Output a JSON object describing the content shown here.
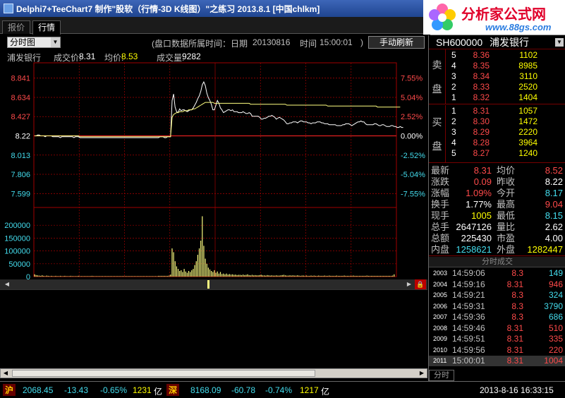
{
  "window": {
    "title": "Delphi7+TeeChart7 制作\"股软（行情-3D K线图）\"之练习  2013.8.1 [中国chlkm]"
  },
  "logo": {
    "brand": "分析家公式网",
    "url": "www.88gs.com"
  },
  "tabs": [
    {
      "label": "报价"
    },
    {
      "label": "行情"
    }
  ],
  "toolbar": {
    "chart_type": "分时图",
    "date_label": "(盘口数据所属时间：日期",
    "date_value": "20130816",
    "time_label": "时间",
    "time_value": "15:00:01",
    "time_close": ")",
    "refresh_label": "手动刷新"
  },
  "info": {
    "stock_name": "浦发银行",
    "price_label": "成交价:",
    "price_value": "8.31",
    "avg_label": "均价:",
    "avg_value": "8.53",
    "vol_label": "成交量:",
    "vol_value": "9282"
  },
  "chart_data": {
    "type": "line",
    "price_axis_labels": [
      "8.841",
      "8.634",
      "8.427",
      "8.22",
      "8.013",
      "7.806",
      "7.599"
    ],
    "price_axis_values": [
      8.841,
      8.634,
      8.427,
      8.22,
      8.013,
      7.806,
      7.599
    ],
    "percent_axis_labels": [
      "7.55%",
      "5.04%",
      "2.52%",
      "0.00%",
      "-2.52%",
      "-5.04%",
      "-7.55%"
    ],
    "volume_axis_labels": [
      "200000",
      "150000",
      "100000",
      "50000",
      "0"
    ],
    "volume_axis_values": [
      200000,
      150000,
      100000,
      50000,
      0
    ],
    "prev_close": 8.22,
    "ylim_price": [
      7.495,
      8.945
    ],
    "ylim_volume": [
      0,
      250000
    ],
    "x_points": 240,
    "grid": true,
    "series": [
      {
        "values": [
          8.22,
          8.22,
          8.23,
          8.23,
          8.22,
          8.22,
          8.22,
          8.21,
          8.22,
          8.22,
          8.22,
          8.22,
          8.21,
          8.21,
          8.21,
          8.21,
          8.21,
          8.2,
          8.21,
          8.21,
          8.21,
          8.21,
          8.21,
          8.21,
          8.21,
          8.21,
          8.2,
          8.21,
          8.21,
          8.21,
          8.2,
          8.2,
          8.2,
          8.2,
          8.2,
          8.2,
          8.2,
          8.2,
          8.2,
          8.2,
          8.2,
          8.2,
          8.2,
          8.2,
          8.2,
          8.2,
          8.2,
          8.2,
          8.2,
          8.2,
          8.2,
          8.2,
          8.2,
          8.2,
          8.2,
          8.2,
          8.2,
          8.2,
          8.2,
          8.2,
          8.2,
          8.2,
          8.2,
          8.2,
          8.2,
          8.2,
          8.2,
          8.2,
          8.2,
          8.2,
          8.2,
          8.2,
          8.2,
          8.2,
          8.2,
          8.2,
          8.2,
          8.2,
          8.2,
          8.2,
          8.2,
          8.2,
          8.2,
          8.21,
          8.21,
          8.21,
          8.2,
          8.2,
          8.21,
          8.21,
          8.21,
          8.6,
          8.67,
          8.53,
          8.48,
          8.47,
          8.51,
          8.49,
          8.5,
          8.5,
          8.49,
          8.48,
          8.49,
          8.5,
          8.5,
          8.52,
          8.55,
          8.58,
          8.62,
          8.65,
          8.7,
          8.77,
          8.8,
          8.76,
          8.68,
          8.63,
          8.6,
          8.56,
          8.5,
          8.5,
          8.55,
          8.6,
          8.57,
          8.52,
          8.5,
          8.47,
          8.48,
          8.49,
          8.5,
          8.5,
          8.49,
          8.5,
          8.48,
          8.48,
          8.48,
          8.47,
          8.47,
          8.47,
          8.48,
          8.47,
          8.46,
          8.46,
          8.47,
          8.46,
          8.43,
          8.43,
          8.43,
          8.43,
          8.43,
          8.42,
          8.4,
          8.4,
          8.41,
          8.41,
          8.42,
          8.43,
          8.43,
          8.44,
          8.43,
          8.42,
          8.4,
          8.41,
          8.42,
          8.41,
          8.4,
          8.39,
          8.37,
          8.35,
          8.35,
          8.36,
          8.36,
          8.37,
          8.37,
          8.37,
          8.36,
          8.37,
          8.38,
          8.38,
          8.37,
          8.37,
          8.37,
          8.36,
          8.36,
          8.35,
          8.36,
          8.36,
          8.36,
          8.37,
          8.37,
          8.37,
          8.36,
          8.36,
          8.35,
          8.35,
          8.35,
          8.34,
          8.34,
          8.34,
          8.34,
          8.34,
          8.33,
          8.33,
          8.33,
          8.33,
          8.34,
          8.34,
          8.35,
          8.35,
          8.35,
          8.34,
          8.33,
          8.34,
          8.35,
          8.36,
          8.37,
          8.37,
          8.38,
          8.37,
          8.37,
          8.35,
          8.34,
          8.34,
          8.34,
          8.34,
          8.34,
          8.35,
          8.35,
          8.34,
          8.33,
          8.33,
          8.34,
          8.34,
          8.33,
          8.32,
          8.32,
          8.32,
          8.33,
          8.33,
          8.32,
          8.32,
          8.31,
          8.31,
          8.32,
          8.31,
          8.31
        ]
      },
      {
        "values": [
          8.22,
          8.22,
          8.22,
          8.22,
          8.22,
          8.22,
          8.22,
          8.22,
          8.22,
          8.22,
          8.22,
          8.22,
          8.22,
          8.22,
          8.22,
          8.22,
          8.22,
          8.22,
          8.22,
          8.22,
          8.22,
          8.22,
          8.22,
          8.22,
          8.22,
          8.22,
          8.22,
          8.22,
          8.22,
          8.22,
          8.21,
          8.21,
          8.21,
          8.21,
          8.21,
          8.21,
          8.21,
          8.21,
          8.21,
          8.21,
          8.21,
          8.21,
          8.21,
          8.21,
          8.21,
          8.21,
          8.21,
          8.21,
          8.21,
          8.21,
          8.21,
          8.21,
          8.21,
          8.21,
          8.21,
          8.21,
          8.21,
          8.21,
          8.21,
          8.21,
          8.21,
          8.21,
          8.21,
          8.21,
          8.21,
          8.21,
          8.21,
          8.21,
          8.21,
          8.21,
          8.21,
          8.21,
          8.21,
          8.21,
          8.21,
          8.21,
          8.21,
          8.21,
          8.21,
          8.21,
          8.21,
          8.21,
          8.21,
          8.21,
          8.21,
          8.21,
          8.21,
          8.21,
          8.21,
          8.21,
          8.21,
          8.42,
          8.45,
          8.46,
          8.47,
          8.47,
          8.48,
          8.48,
          8.48,
          8.49,
          8.49,
          8.49,
          8.5,
          8.5,
          8.5,
          8.51,
          8.51,
          8.52,
          8.53,
          8.54,
          8.55,
          8.56,
          8.57,
          8.58,
          8.58,
          8.58,
          8.58,
          8.58,
          8.58,
          8.57,
          8.57,
          8.57,
          8.57,
          8.57,
          8.57,
          8.57,
          8.57,
          8.57,
          8.57,
          8.57,
          8.57,
          8.57,
          8.57,
          8.57,
          8.57,
          8.57,
          8.57,
          8.57,
          8.57,
          8.57,
          8.57,
          8.57,
          8.57,
          8.56,
          8.56,
          8.56,
          8.56,
          8.56,
          8.56,
          8.56,
          8.56,
          8.56,
          8.56,
          8.56,
          8.56,
          8.56,
          8.56,
          8.56,
          8.56,
          8.56,
          8.56,
          8.56,
          8.56,
          8.56,
          8.56,
          8.56,
          8.56,
          8.55,
          8.55,
          8.55,
          8.55,
          8.55,
          8.55,
          8.55,
          8.55,
          8.55,
          8.55,
          8.55,
          8.55,
          8.55,
          8.55,
          8.55,
          8.55,
          8.55,
          8.55,
          8.55,
          8.55,
          8.55,
          8.55,
          8.55,
          8.55,
          8.55,
          8.55,
          8.55,
          8.54,
          8.54,
          8.54,
          8.54,
          8.54,
          8.54,
          8.54,
          8.54,
          8.54,
          8.54,
          8.54,
          8.54,
          8.54,
          8.54,
          8.54,
          8.54,
          8.54,
          8.54,
          8.54,
          8.54,
          8.54,
          8.54,
          8.54,
          8.54,
          8.54,
          8.54,
          8.54,
          8.54,
          8.54,
          8.54,
          8.54,
          8.54,
          8.54,
          8.53,
          8.53,
          8.53,
          8.53,
          8.53,
          8.53,
          8.53,
          8.53,
          8.53,
          8.53,
          8.53,
          8.53,
          8.53,
          8.53,
          8.53,
          8.53
        ]
      }
    ],
    "volume": [
      9000,
      6000,
      5000,
      4000,
      3000,
      5000,
      3000,
      2000,
      4000,
      3000,
      2000,
      3000,
      2000,
      2000,
      3000,
      2000,
      2000,
      3000,
      2000,
      2000,
      3000,
      2000,
      2000,
      2000,
      3000,
      2000,
      2000,
      2000,
      2000,
      3000,
      2000,
      2000,
      2000,
      2000,
      2000,
      2000,
      2000,
      2000,
      3000,
      2000,
      2000,
      2000,
      2000,
      2000,
      2000,
      2000,
      2000,
      2000,
      2000,
      2000,
      2000,
      2000,
      2000,
      2000,
      2000,
      2000,
      2000,
      2000,
      2000,
      2000,
      2000,
      2000,
      2000,
      2000,
      2000,
      2000,
      2000,
      2000,
      2000,
      2000,
      2000,
      2000,
      2000,
      2000,
      2000,
      2000,
      2000,
      2000,
      2000,
      2000,
      2000,
      2000,
      3000,
      3000,
      3000,
      3000,
      3000,
      3000,
      3000,
      4000,
      8000,
      110000,
      95000,
      60000,
      40000,
      30000,
      22000,
      25000,
      18000,
      30000,
      20000,
      15000,
      22000,
      18000,
      25000,
      30000,
      45000,
      60000,
      85000,
      110000,
      140000,
      235000,
      120000,
      70000,
      50000,
      35000,
      28000,
      22000,
      18000,
      25000,
      15000,
      20000,
      12000,
      18000,
      10000,
      12000,
      9000,
      12000,
      8000,
      10000,
      8000,
      9000,
      7000,
      8000,
      6000,
      7000,
      7000,
      6000,
      8000,
      6000,
      7000,
      9000,
      6000,
      5000,
      7000,
      5000,
      6000,
      5000,
      5000,
      6000,
      7000,
      5000,
      5000,
      4000,
      6000,
      5000,
      4000,
      5000,
      4000,
      4000,
      5000,
      4000,
      4000,
      5000,
      6000,
      7000,
      5000,
      4000,
      4000,
      5000,
      4000,
      5000,
      4000,
      4000,
      5000,
      4000,
      3000,
      4000,
      4000,
      3000,
      4000,
      3000,
      3000,
      4000,
      3000,
      4000,
      3000,
      3000,
      4000,
      3000,
      3000,
      3000,
      4000,
      3000,
      3000,
      4000,
      3000,
      3000,
      3000,
      3000,
      4000,
      3000,
      3000,
      3000,
      3000,
      4000,
      3000,
      3000,
      3000,
      3000,
      3000,
      4000,
      3000,
      3000,
      3000,
      3000,
      3000,
      3000,
      3000,
      3000,
      4000,
      3000,
      3000,
      3000,
      3000,
      3000,
      3000,
      3000,
      3000,
      3000,
      3000,
      3000,
      3000,
      3000,
      3000,
      3000,
      3000,
      4000,
      9000
    ],
    "colors": {
      "price": "#ffffff",
      "avg": "#ffff80",
      "volume": "#ffff80",
      "grid": "#a00000"
    }
  },
  "quote": {
    "symbol": "SH600000",
    "name": "浦发银行",
    "sell_label_1": "卖",
    "sell_label_2": "盘",
    "buy_label_1": "买",
    "buy_label_2": "盘",
    "sell": [
      {
        "level": "5",
        "price": "8.36",
        "vol": "1102"
      },
      {
        "level": "4",
        "price": "8.35",
        "vol": "8985"
      },
      {
        "level": "3",
        "price": "8.34",
        "vol": "3110"
      },
      {
        "level": "2",
        "price": "8.33",
        "vol": "2520"
      },
      {
        "level": "1",
        "price": "8.32",
        "vol": "1404"
      }
    ],
    "buy": [
      {
        "level": "1",
        "price": "8.31",
        "vol": "1057"
      },
      {
        "level": "2",
        "price": "8.30",
        "vol": "1472"
      },
      {
        "level": "3",
        "price": "8.29",
        "vol": "2220"
      },
      {
        "level": "4",
        "price": "8.28",
        "vol": "3964"
      },
      {
        "level": "5",
        "price": "8.27",
        "vol": "1240"
      }
    ],
    "stats": [
      {
        "l1": "最新",
        "v1": "8.31",
        "l2": "均价",
        "v2": "8.52"
      },
      {
        "l1": "涨跌",
        "v1": "0.09",
        "l2": "昨收",
        "v2": "8.22"
      },
      {
        "l1": "涨幅",
        "v1": "1.09%",
        "l2": "今开",
        "v2": "8.17"
      },
      {
        "l1": "换手",
        "v1": "1.77%",
        "l2": "最高",
        "v2": "9.04"
      },
      {
        "l1": "现手",
        "v1": "1005",
        "l2": "最低",
        "v2": "8.15"
      },
      {
        "l1": "总手",
        "v1": "2647126",
        "l2": "量比",
        "v2": "2.62"
      },
      {
        "l1": "总额",
        "v1": "225430",
        "l2": "市盈",
        "v2": "4.00"
      },
      {
        "l1": "内盘",
        "v1": "1258621",
        "l2": "外盘",
        "v2": "1282447"
      }
    ],
    "stat_colors": [
      [
        "#ff4a4a",
        "#ff4a4a"
      ],
      [
        "#ff4a4a",
        "#ffffff"
      ],
      [
        "#ff4a4a",
        "#44ddee"
      ],
      [
        "#ffffff",
        "#ff4a4a"
      ],
      [
        "#ffff00",
        "#44ddee"
      ],
      [
        "#ffffff",
        "#ffffff"
      ],
      [
        "#ffffff",
        "#ffffff"
      ],
      [
        "#44ddee",
        "#ffff00"
      ]
    ]
  },
  "ticks": {
    "header": "分时成交",
    "tab_label": "分时",
    "rows": [
      {
        "no": "2003",
        "time": "14:59:06",
        "price": "8.3",
        "vol": "149",
        "pc": "#ff4a4a",
        "vc": "#44ddee"
      },
      {
        "no": "2004",
        "time": "14:59:16",
        "price": "8.31",
        "vol": "946",
        "pc": "#ff4a4a",
        "vc": "#ff4a4a"
      },
      {
        "no": "2005",
        "time": "14:59:21",
        "price": "8.3",
        "vol": "324",
        "pc": "#ff4a4a",
        "vc": "#44ddee"
      },
      {
        "no": "2006",
        "time": "14:59:31",
        "price": "8.3",
        "vol": "3790",
        "pc": "#ff4a4a",
        "vc": "#44ddee"
      },
      {
        "no": "2007",
        "time": "14:59:36",
        "price": "8.3",
        "vol": "686",
        "pc": "#ff4a4a",
        "vc": "#44ddee"
      },
      {
        "no": "2008",
        "time": "14:59:46",
        "price": "8.31",
        "vol": "510",
        "pc": "#ff4a4a",
        "vc": "#ff4a4a"
      },
      {
        "no": "2009",
        "time": "14:59:51",
        "price": "8.31",
        "vol": "335",
        "pc": "#ff4a4a",
        "vc": "#ff4a4a"
      },
      {
        "no": "2010",
        "time": "14:59:56",
        "price": "8.31",
        "vol": "220",
        "pc": "#ff4a4a",
        "vc": "#ff4a4a"
      },
      {
        "no": "2011",
        "time": "15:00:01",
        "price": "8.31",
        "vol": "1004",
        "pc": "#ff4a4a",
        "vc": "#ff4a4a"
      }
    ]
  },
  "status": {
    "sh_label": "沪",
    "sh_index": "2068.45",
    "sh_change": "-13.43",
    "sh_pct": "-0.65%",
    "sh_amount": "1231",
    "sh_unit": "亿",
    "sz_label": "深",
    "sz_index": "8168.09",
    "sz_change": "-60.78",
    "sz_pct": "-0.74%",
    "sz_amount": "1217",
    "sz_unit": "亿",
    "datetime": "2013-8-16 16:33:15"
  }
}
